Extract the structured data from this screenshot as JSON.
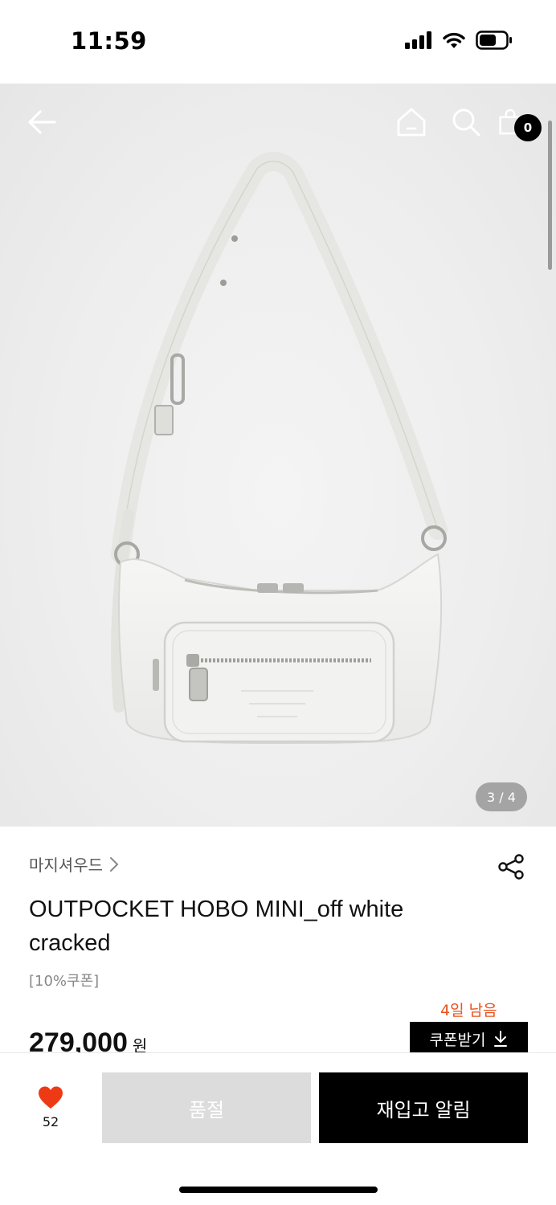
{
  "status_bar": {
    "time": "11:59"
  },
  "hero": {
    "page_indicator": "3 / 4",
    "cart_count": "0",
    "icons": [
      "back-arrow-icon",
      "home-icon",
      "search-icon",
      "shopping-bag-icon"
    ]
  },
  "product": {
    "brand": "마지셔우드",
    "name_line1": "OUTPOCKET HOBO MINI_off white",
    "name_line2": "cracked",
    "coupon_tag": "[10%쿠폰]",
    "days_left": "4일 남음",
    "price": "279,000",
    "price_unit": "원",
    "coupon_button": "쿠폰받기"
  },
  "bottom_bar": {
    "like_count": "52",
    "soldout_label": "품절",
    "restock_label": "재입고 알림"
  },
  "colors": {
    "accent": "#e8521e",
    "heart": "#ee3a14",
    "primary": "#000000",
    "disabled": "#dcdcdc"
  }
}
